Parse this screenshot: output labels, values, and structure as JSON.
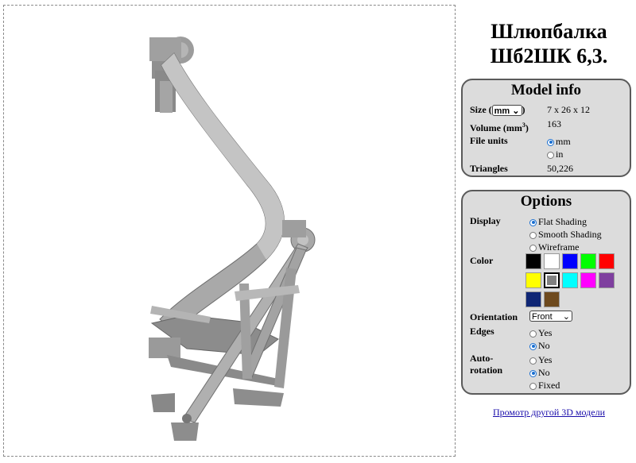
{
  "title": "Шлюпбалка Шб2ШК 6,3.",
  "model_info": {
    "heading": "Model info",
    "size_label_pre": "Size (",
    "size_label_post": ")",
    "size_unit": "mm",
    "size_value": "7 x 26 x 12",
    "volume_label": "Volume (mm",
    "volume_sup": "3",
    "volume_label_post": ")",
    "volume_value": "163",
    "file_units_label": "File units",
    "file_units_options": [
      "mm",
      "in"
    ],
    "file_units_selected": "mm",
    "triangles_label": "Triangles",
    "triangles_value": "50,226"
  },
  "options": {
    "heading": "Options",
    "display_label": "Display",
    "display_options": [
      "Flat Shading",
      "Smooth Shading",
      "Wireframe"
    ],
    "display_selected": "Flat Shading",
    "color_label": "Color",
    "colors": [
      "#000000",
      "#ffffff",
      "#0000ff",
      "#00ff00",
      "#ff0000",
      "#ffff00",
      "#808080",
      "#00ffff",
      "#ff00ff",
      "#7f3f9f",
      "#0f2675",
      "#6e4a1e"
    ],
    "color_selected": "#808080",
    "orientation_label": "Orientation",
    "orientation_value": "Front",
    "edges_label": "Edges",
    "edges_options": [
      "Yes",
      "No"
    ],
    "edges_selected": "No",
    "autorotation_label_1": "Auto-",
    "autorotation_label_2": "rotation",
    "autorotation_options": [
      "Yes",
      "No",
      "Fixed"
    ],
    "autorotation_selected": "No"
  },
  "link": "Промотр другой 3D модели"
}
